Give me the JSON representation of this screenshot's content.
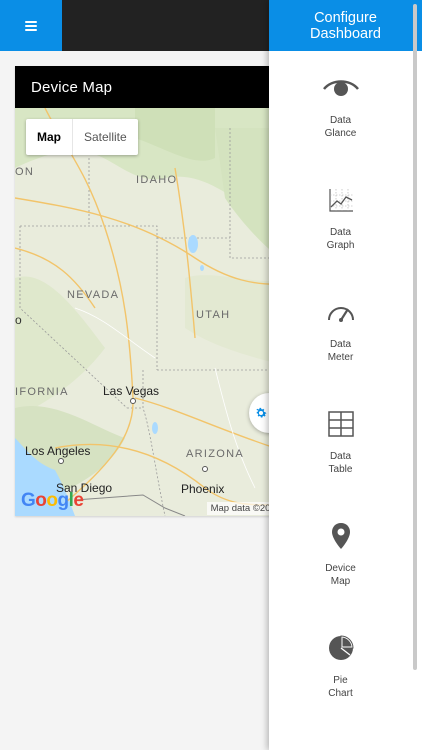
{
  "topbar": {
    "menu_icon": "hamburger-menu-icon"
  },
  "card": {
    "title": "Device Map"
  },
  "map": {
    "type_buttons": [
      "Map",
      "Satellite"
    ],
    "active_type": "Map",
    "state_labels": [
      "IDAHO",
      "NEVADA",
      "UTAH",
      "ARIZONA",
      "IFORNIA"
    ],
    "city_labels": [
      "Las Vegas",
      "Los Angeles",
      "San Diego",
      "Phoenix"
    ],
    "edge_labels": [
      "ON",
      "o"
    ],
    "logo": "Google",
    "attribution": "Map data ©2018 G"
  },
  "drawer": {
    "title_line1": "Configure",
    "title_line2": "Dashboard",
    "items": [
      {
        "line1": "Data",
        "line2": "Glance",
        "icon": "eye-icon"
      },
      {
        "line1": "Data",
        "line2": "Graph",
        "icon": "line-graph-icon"
      },
      {
        "line1": "Data",
        "line2": "Meter",
        "icon": "gauge-icon"
      },
      {
        "line1": "Data",
        "line2": "Table",
        "icon": "table-icon"
      },
      {
        "line1": "Device",
        "line2": "Map",
        "icon": "map-pin-icon"
      },
      {
        "line1": "Pie",
        "line2": "Chart",
        "icon": "pie-chart-icon"
      }
    ]
  },
  "colors": {
    "accent": "#0a8ee6",
    "header_dark": "#222222",
    "card_header": "#000000"
  }
}
